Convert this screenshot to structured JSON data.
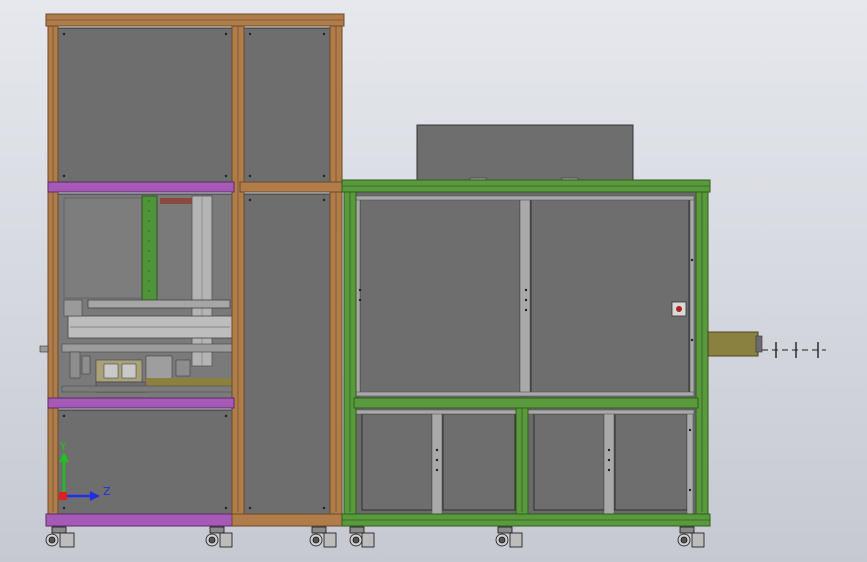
{
  "viewport": {
    "background_top": "#e4e6ec",
    "background_bottom": "#c9ccd4"
  },
  "colors": {
    "panel": "#6f6f6f",
    "panel_edge": "#3a3a3a",
    "orange_frame": "#b07c4a",
    "orange_dark": "#6e4a26",
    "green_frame": "#5a9a3c",
    "green_dark": "#2e5e1e",
    "purple_frame": "#a55ab5",
    "purple_dark": "#5e2a6a",
    "inner_light": "#a9a9a9",
    "olive_part": "#8a8040",
    "axis_x_red": "#e02020",
    "axis_y_green": "#20c020",
    "axis_z_blue": "#2030e0"
  },
  "axis_triad": {
    "y_label": "Y",
    "z_label": "Z"
  },
  "icons": {
    "triad": "coordinate-axis-triad-icon",
    "casters": "caster-wheel-icon",
    "door_button": "emergency-button-icon"
  }
}
